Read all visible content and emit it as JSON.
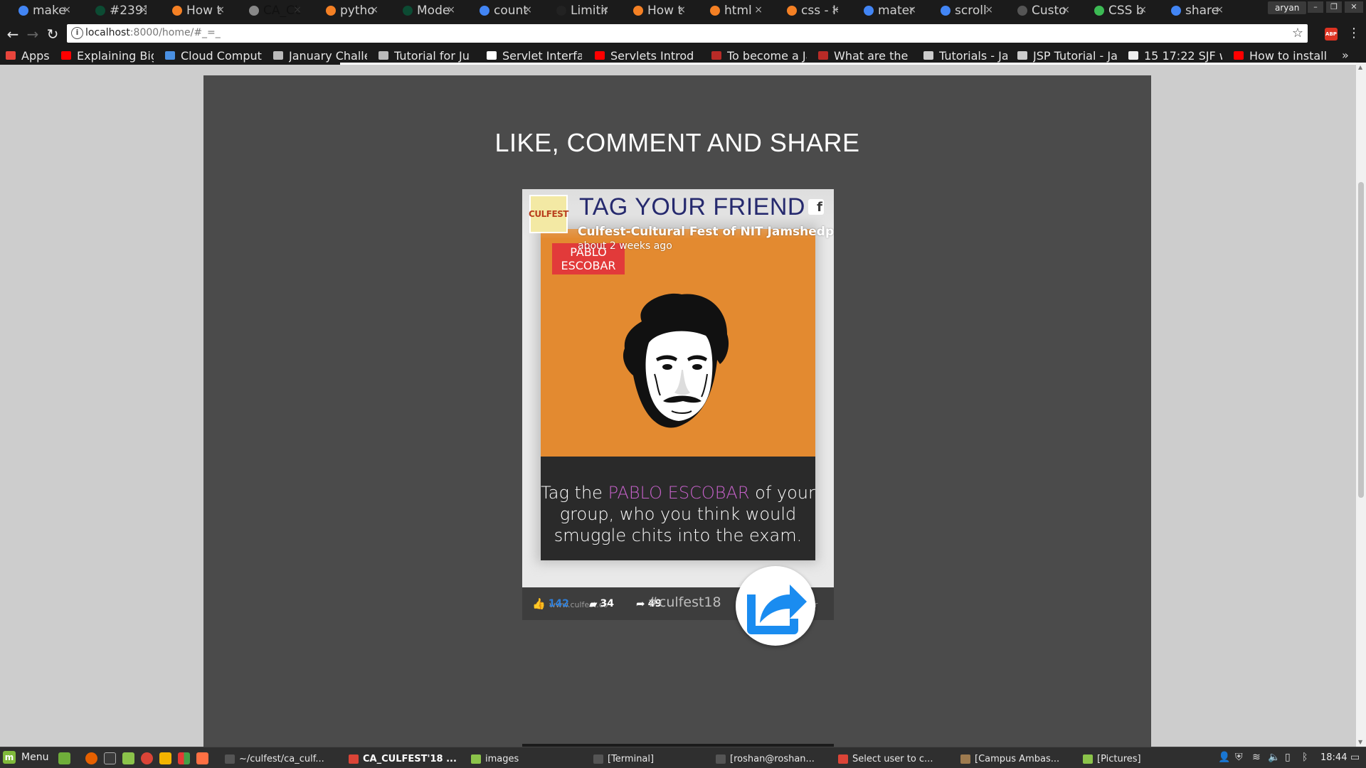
{
  "browser": {
    "tabs": [
      {
        "label": "make",
        "icon": "google-icon",
        "color": "#4285f4",
        "active": false
      },
      {
        "label": "#2391",
        "icon": "django-icon",
        "color": "#0c4b33",
        "active": false
      },
      {
        "label": "How t",
        "icon": "stackoverflow-icon",
        "color": "#f48024",
        "active": false
      },
      {
        "label": "CA_CU",
        "icon": "page-icon",
        "color": "#888888",
        "active": true
      },
      {
        "label": "pytho",
        "icon": "stackoverflow-icon",
        "color": "#f48024",
        "active": false
      },
      {
        "label": "Mode",
        "icon": "django-icon",
        "color": "#0c4b33",
        "active": false
      },
      {
        "label": "count",
        "icon": "google-icon",
        "color": "#4285f4",
        "active": false
      },
      {
        "label": "Limitir",
        "icon": "github-icon",
        "color": "#222222",
        "active": false
      },
      {
        "label": "How t",
        "icon": "stackoverflow-icon",
        "color": "#f48024",
        "active": false
      },
      {
        "label": "html",
        "icon": "stackoverflow-icon",
        "color": "#f48024",
        "active": false
      },
      {
        "label": "css - H",
        "icon": "stackoverflow-icon",
        "color": "#f48024",
        "active": false
      },
      {
        "label": "mater",
        "icon": "google-icon",
        "color": "#4285f4",
        "active": false
      },
      {
        "label": "scroll",
        "icon": "google-icon",
        "color": "#4285f4",
        "active": false
      },
      {
        "label": "Custo",
        "icon": "codepen-icon",
        "color": "#555555",
        "active": false
      },
      {
        "label": "CSS b",
        "icon": "css-icon",
        "color": "#3cba54",
        "active": false
      },
      {
        "label": "share",
        "icon": "google-icon",
        "color": "#4285f4",
        "active": false
      }
    ],
    "profile_name": "aryan",
    "url_host": "localhost",
    "url_rest": ":8000/home/#_=_",
    "bookmarks": [
      {
        "label": "Apps",
        "icon": "apps-grid-icon",
        "color": "#e8453c"
      },
      {
        "label": "Explaining Big",
        "icon": "youtube-icon",
        "color": "#ff0000"
      },
      {
        "label": "Cloud Comput",
        "icon": "infinity-icon",
        "color": "#4a90e2"
      },
      {
        "label": "January Challe",
        "icon": "cc-icon",
        "color": "#bbbbbb"
      },
      {
        "label": "Tutorial for Ju",
        "icon": "cc-icon",
        "color": "#bbbbbb"
      },
      {
        "label": "Servlet Interfa",
        "icon": "s-icon",
        "color": "#ffffff"
      },
      {
        "label": "Servlets Introd",
        "icon": "youtube-icon",
        "color": "#ff0000"
      },
      {
        "label": "To become a Ja",
        "icon": "quora-icon",
        "color": "#b92b27"
      },
      {
        "label": "What are the b",
        "icon": "quora-icon",
        "color": "#b92b27"
      },
      {
        "label": "Tutorials - Java",
        "icon": "t-icon",
        "color": "#cccccc"
      },
      {
        "label": "JSP Tutorial - Ja",
        "icon": "t-icon",
        "color": "#cccccc"
      },
      {
        "label": "15 17:22 SJF wi",
        "icon": "page-icon",
        "color": "#eeeeee"
      },
      {
        "label": "How to install",
        "icon": "youtube-icon",
        "color": "#ff0000"
      }
    ]
  },
  "page": {
    "section_title": "LIKE, COMMENT AND SHARE",
    "post": {
      "logo_text": "CULFEST",
      "headline": "TAG YOUR FRIEND",
      "page_name": "Culfest-Cultural Fest of NIT Jamshedpur",
      "time": "about 2 weeks ago",
      "poster_tag": "PABLO ESCOBAR",
      "caption_before": "Tag the ",
      "caption_highlight": "PABLO ESCOBAR",
      "caption_after": " of your group, who you think would smuggle chits into the exam.",
      "likes": "142",
      "comments": "34",
      "shares": "49",
      "hashtag": "#culfest18",
      "footer_url": "www.culfest.co",
      "footer_right": "ar"
    },
    "colors": {
      "panel": "#4b4b4b",
      "poster_orange": "#e38a30",
      "headline_navy": "#262a6e",
      "highlight_purple": "#c561c9",
      "share_blue": "#1a8cf0"
    }
  },
  "taskbar": {
    "menu_label": "Menu",
    "tasks": [
      {
        "label": "~/culfest/ca_culf...",
        "icon": "terminal-icon",
        "active": false
      },
      {
        "label": "CA_CULFEST'18 ...",
        "icon": "chrome-icon",
        "active": true
      },
      {
        "label": "images",
        "icon": "folder-icon",
        "active": false
      },
      {
        "label": "[Terminal]",
        "icon": "terminal-icon",
        "active": false
      },
      {
        "label": "[roshan@roshan...",
        "icon": "terminal-icon",
        "active": false
      },
      {
        "label": "Select user to c...",
        "icon": "chrome-icon",
        "active": false
      },
      {
        "label": "[Campus Ambas...",
        "icon": "gimp-icon",
        "active": false
      },
      {
        "label": "[Pictures]",
        "icon": "folder-icon",
        "active": false
      }
    ],
    "clock": "18:44"
  }
}
